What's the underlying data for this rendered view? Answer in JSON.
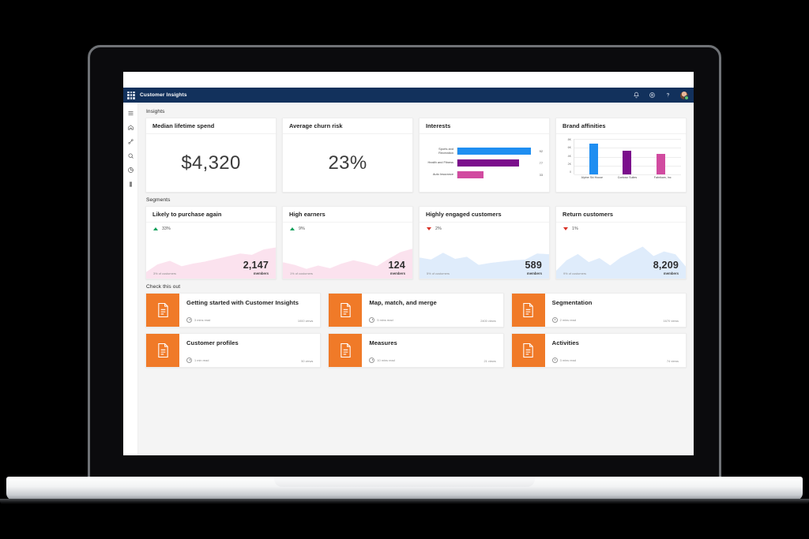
{
  "app": {
    "title": "Customer Insights",
    "waffle_icon": "app-launcher-icon",
    "icons": [
      "notification-bell-icon",
      "settings-gear-icon",
      "help-question-icon"
    ],
    "avatar": "user-avatar"
  },
  "rail": {
    "items": [
      {
        "name": "hamburger-menu-icon"
      },
      {
        "name": "home-icon"
      },
      {
        "name": "data-sources-icon"
      },
      {
        "name": "search-icon"
      },
      {
        "name": "segments-pie-icon"
      },
      {
        "name": "measures-bar-icon"
      }
    ]
  },
  "sections": {
    "insights": "Insights",
    "segments": "Segments",
    "check_this_out": "Check this out"
  },
  "kpis": [
    {
      "title": "Median lifetime spend",
      "value": "$4,320"
    },
    {
      "title": "Average churn risk",
      "value": "23%"
    }
  ],
  "chart_data": [
    {
      "type": "bar",
      "orientation": "horizontal",
      "title": "Interests",
      "categories": [
        "Sports and Recreation",
        "Health and Fitness",
        "Auto Insurance"
      ],
      "values": [
        92,
        77,
        33
      ],
      "colors": [
        "#1f8ef1",
        "#7b0e8c",
        "#d14ba0"
      ],
      "xlabel": "",
      "ylabel": "",
      "xlim": [
        0,
        100
      ],
      "grid": false,
      "legend": false
    },
    {
      "type": "bar",
      "orientation": "vertical",
      "title": "Brand affinities",
      "categories": [
        "Alpine Ski House",
        "Contoso Suites",
        "Fabrikam, Inc"
      ],
      "values": [
        7000,
        5300,
        4700
      ],
      "colors": [
        "#1f8ef1",
        "#7b0e8c",
        "#d14ba0"
      ],
      "ytick_labels": [
        "8K",
        "6K",
        "4K",
        "2K",
        "0"
      ],
      "ylim": [
        0,
        8000
      ],
      "grid": true,
      "legend": false
    },
    {
      "type": "area",
      "title": "Likely to purchase again",
      "values": [
        18,
        42,
        52,
        36,
        44,
        50,
        58,
        66,
        74,
        70,
        86,
        92
      ],
      "ylim": [
        0,
        100
      ],
      "color": "#e8428f",
      "fill": "#fbe2ee",
      "grid": false,
      "legend": false
    },
    {
      "type": "area",
      "title": "High earners",
      "values": [
        48,
        40,
        28,
        38,
        30,
        44,
        54,
        46,
        36,
        58,
        78,
        88
      ],
      "ylim": [
        0,
        100
      ],
      "color": "#e8428f",
      "fill": "#fbe2ee",
      "grid": false,
      "legend": false
    },
    {
      "type": "area",
      "title": "Highly engaged customers",
      "values": [
        62,
        56,
        76,
        58,
        64,
        40,
        46,
        50,
        54,
        56,
        74,
        72
      ],
      "ylim": [
        0,
        100
      ],
      "color": "#5aa0e0",
      "fill": "#dfecfb",
      "grid": false,
      "legend": false
    },
    {
      "type": "area",
      "title": "Return customers",
      "values": [
        22,
        54,
        72,
        48,
        60,
        38,
        62,
        78,
        94,
        66,
        80,
        72,
        34
      ],
      "ylim": [
        0,
        100
      ],
      "color": "#5aa0e0",
      "fill": "#dfecfb",
      "grid": false,
      "legend": false
    }
  ],
  "segments": [
    {
      "title": "Likely to purchase again",
      "delta": "33%",
      "direction": "up",
      "footer": "3% of customers",
      "value": "2,147",
      "unit": "members"
    },
    {
      "title": "High earners",
      "delta": "9%",
      "direction": "up",
      "footer": "1% of customers",
      "value": "124",
      "unit": "members"
    },
    {
      "title": "Highly engaged customers",
      "delta": "2%",
      "direction": "down",
      "footer": "5% of customers",
      "value": "589",
      "unit": "members"
    },
    {
      "title": "Return customers",
      "delta": "1%",
      "direction": "down",
      "footer": "9% of customers",
      "value": "8,209",
      "unit": "members"
    }
  ],
  "tiles": [
    [
      {
        "title": "Getting started with Customer Insights",
        "read": "3 mins read",
        "views": "1000 views",
        "icon": "document-icon"
      },
      {
        "title": "Customer profiles",
        "read": "1 min read",
        "views": "50 views",
        "icon": "document-icon"
      }
    ],
    [
      {
        "title": "Map, match, and merge",
        "read": "5 mins read",
        "views": "2400 views",
        "icon": "document-icon"
      },
      {
        "title": "Measures",
        "read": "10 mins read",
        "views": "21 views",
        "icon": "document-icon"
      }
    ],
    [
      {
        "title": "Segmentation",
        "read": "2 mins read",
        "views": "1670 views",
        "icon": "document-icon"
      },
      {
        "title": "Activities",
        "read": "3 mins read",
        "views": "74 views",
        "icon": "document-icon"
      }
    ]
  ],
  "colors": {
    "appbar": "#12315c",
    "accent_orange": "#f07a28",
    "up": "#13a05c",
    "down": "#d93025"
  }
}
